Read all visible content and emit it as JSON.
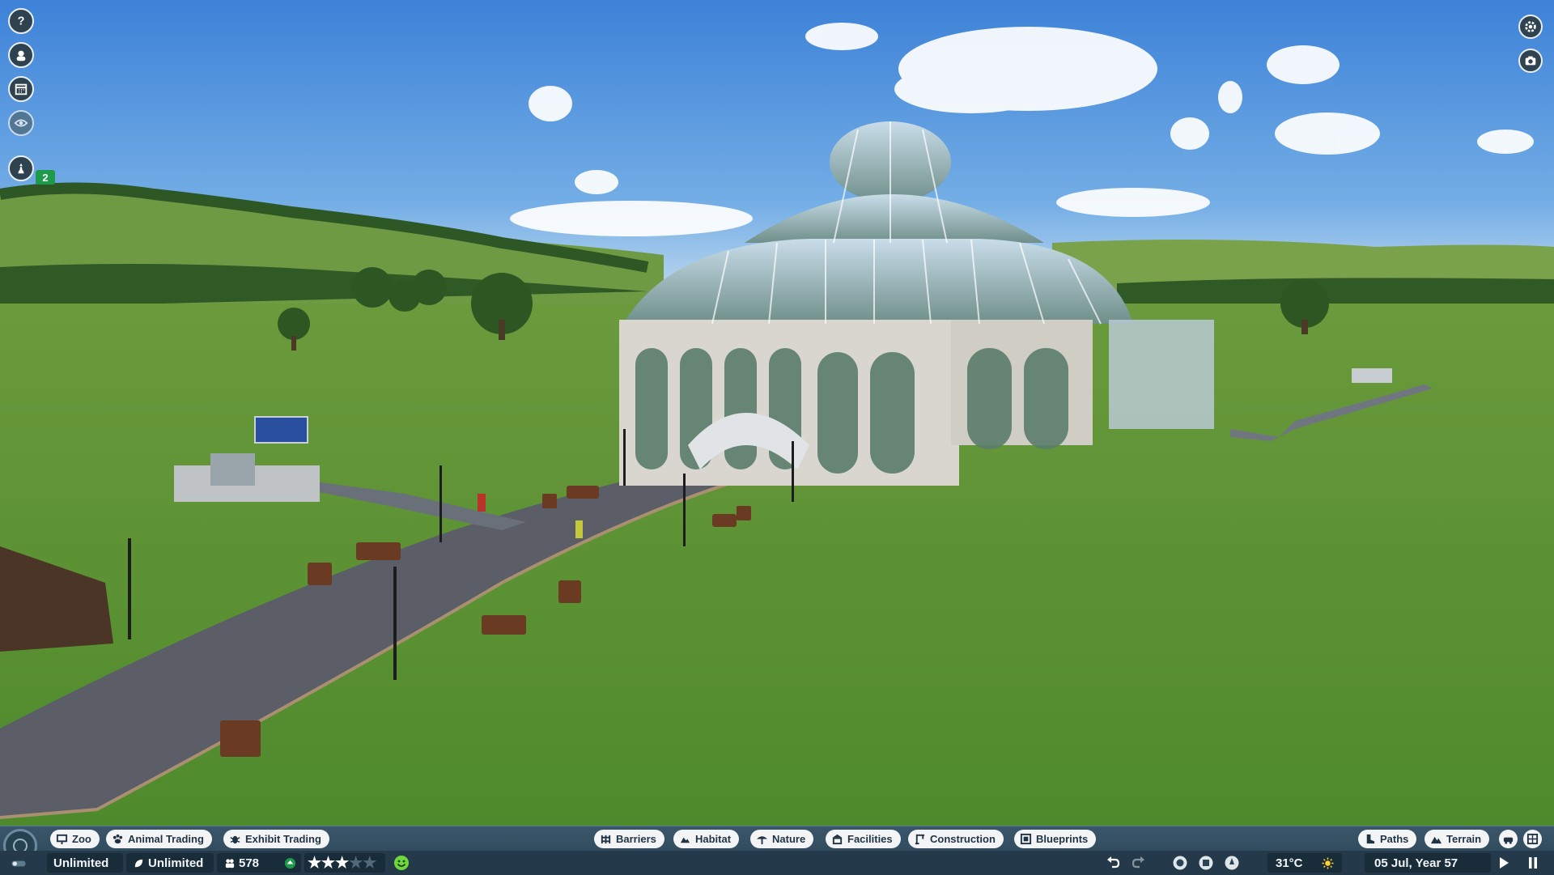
{
  "left_toolbar": {
    "icons": [
      "help-icon",
      "zookeeper-icon",
      "calendar-icon",
      "view-eye-icon",
      "scenario-icon"
    ],
    "scenario_count": "2"
  },
  "right_toolbar": {
    "icons": [
      "settings-icon",
      "photo-mode-icon"
    ]
  },
  "bottom_toolbar": {
    "left_tabs": [
      {
        "label": "Zoo",
        "icon": "zoo-sign-icon"
      },
      {
        "label": "Animal Trading",
        "icon": "paw-icon"
      },
      {
        "label": "Exhibit Trading",
        "icon": "bug-icon"
      }
    ],
    "center_tabs": [
      {
        "label": "Barriers",
        "icon": "fence-icon"
      },
      {
        "label": "Habitat",
        "icon": "habitat-icon"
      },
      {
        "label": "Nature",
        "icon": "tree-icon"
      },
      {
        "label": "Facilities",
        "icon": "shop-icon"
      },
      {
        "label": "Construction",
        "icon": "crane-icon"
      },
      {
        "label": "Blueprints",
        "icon": "blueprint-icon"
      }
    ],
    "right_tabs": [
      {
        "label": "Paths",
        "icon": "boot-icon"
      },
      {
        "label": "Terrain",
        "icon": "mountain-icon"
      }
    ],
    "right_icon_buttons": [
      "track-ride-icon",
      "grid-toggle-icon"
    ]
  },
  "status_bar": {
    "money": "Unlimited",
    "conservation_credits": "Unlimited",
    "guest_count": "578",
    "zoo_rating_stars": 3,
    "zoo_rating_max": 5,
    "guest_mood": "happy",
    "temperature": "31°C",
    "weather": "sunny",
    "date": "05 Jul, Year 57"
  },
  "colors": {
    "bar": "#2b4354",
    "pill": "#f3f4f5",
    "pill_text": "#1f3344",
    "badge_green": "#1f9a4a",
    "mood_green": "#6ed83a"
  }
}
